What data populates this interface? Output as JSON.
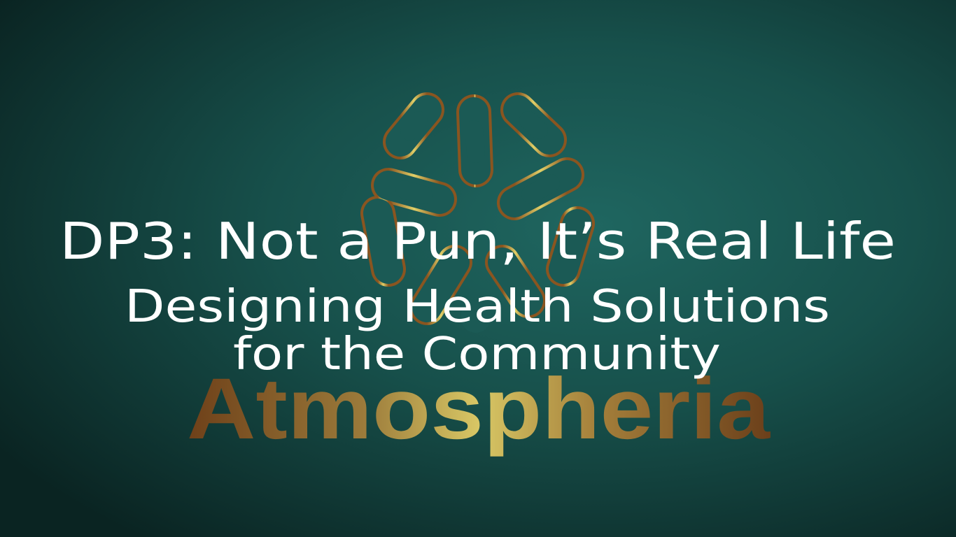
{
  "slide": {
    "title": "DP3: Not a Pun, It’s Real Life",
    "subtitle_line1": "Designing Health Solutions",
    "subtitle_line2": "for the Community"
  },
  "logo": {
    "icon": "brain-network-icon",
    "wordmark": "Atmospheria",
    "colors": {
      "gold": "#d9c462",
      "bronze": "#7a4a1c",
      "background": "#1a5a55"
    }
  }
}
